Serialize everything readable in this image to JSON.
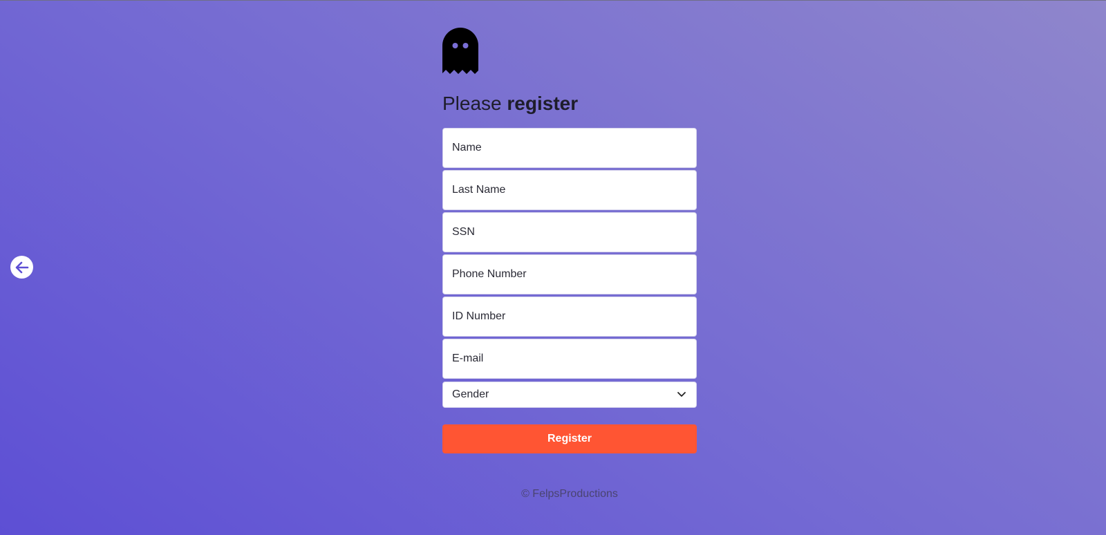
{
  "back_icon": "arrow-left-icon",
  "logo_icon": "ghost-icon",
  "heading": {
    "prefix": "Please",
    "emphasis": "register"
  },
  "form": {
    "name_placeholder": "Name",
    "last_name_placeholder": "Last Name",
    "ssn_placeholder": "SSN",
    "phone_placeholder": "Phone Number",
    "id_number_placeholder": "ID Number",
    "email_placeholder": "E-mail",
    "gender_selected": "Gender",
    "submit_label": "Register"
  },
  "footer": {
    "text": "© FelpsProductions"
  },
  "colors": {
    "accent": "#ff5533",
    "background_start": "#5d4fd4",
    "background_end": "#8f86cc"
  }
}
